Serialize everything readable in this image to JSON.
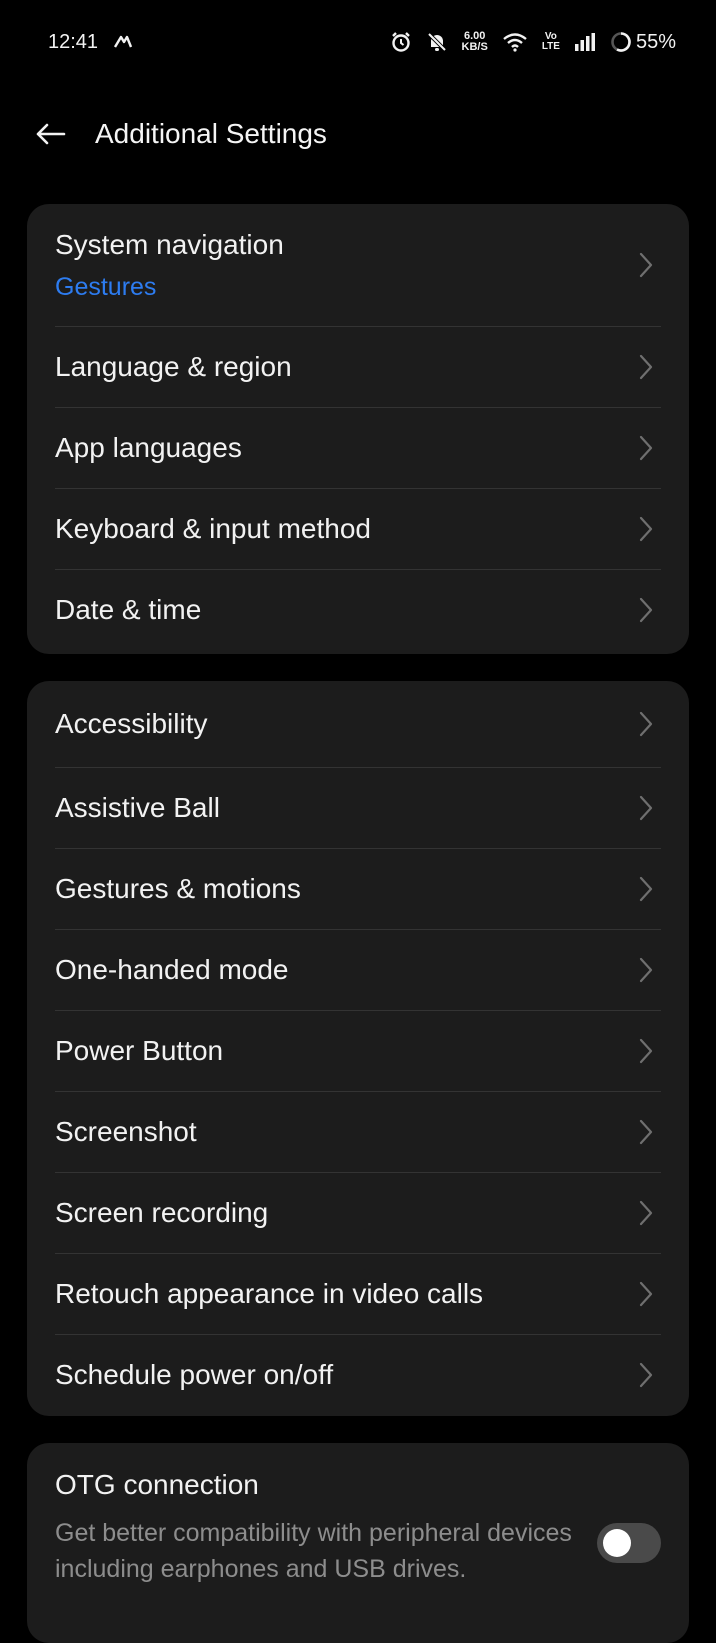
{
  "status_bar": {
    "time": "12:41",
    "net_speed_value": "6.00",
    "net_speed_unit": "KB/S",
    "volte_top": "Vo",
    "volte_bottom": "LTE",
    "battery": "55%",
    "icons": [
      "app-notification-icon",
      "alarm-icon",
      "mute-icon",
      "wifi-icon",
      "signal-icon",
      "battery-icon"
    ]
  },
  "header": {
    "title": "Additional Settings"
  },
  "group1": {
    "system_navigation": {
      "label": "System navigation",
      "value": "Gestures"
    },
    "items": [
      {
        "label": "Language & region"
      },
      {
        "label": "App languages"
      },
      {
        "label": "Keyboard & input method"
      },
      {
        "label": "Date & time"
      }
    ]
  },
  "group2": {
    "items": [
      {
        "label": "Accessibility"
      },
      {
        "label": "Assistive Ball"
      },
      {
        "label": "Gestures & motions"
      },
      {
        "label": "One-handed mode"
      },
      {
        "label": "Power Button"
      },
      {
        "label": "Screenshot"
      },
      {
        "label": "Screen recording"
      },
      {
        "label": "Retouch appearance in video calls"
      },
      {
        "label": "Schedule power on/off"
      }
    ]
  },
  "otg": {
    "title": "OTG connection",
    "description": "Get better compatibility with peripheral devices including earphones and USB drives.",
    "enabled": false
  },
  "colors": {
    "accent": "#2d7cf0",
    "card_bg": "#1c1c1c",
    "background": "#000000"
  }
}
